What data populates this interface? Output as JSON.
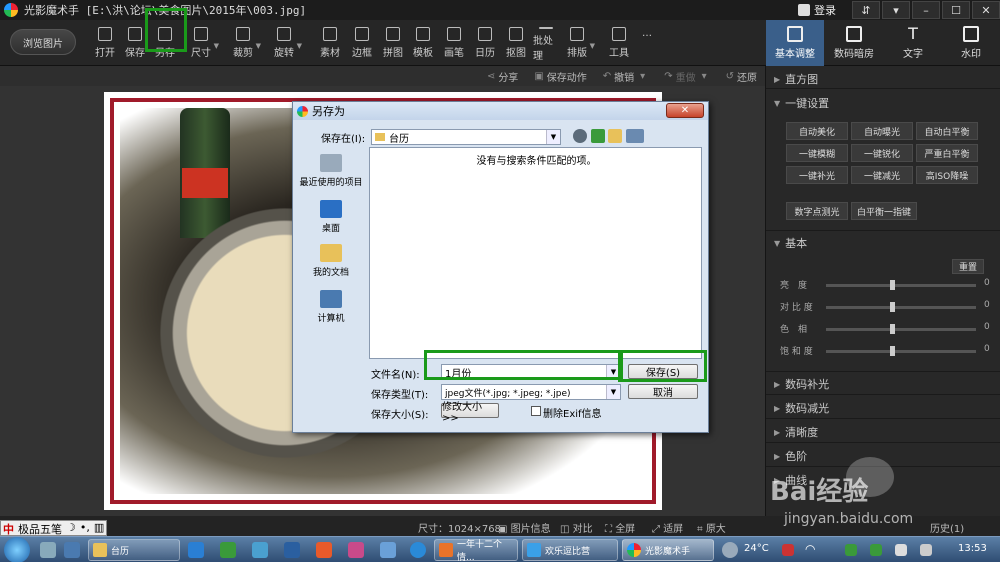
{
  "app": {
    "name": "光影魔术手",
    "title_path": "[E:\\洪\\论坛\\美食图片\\2015年\\003.jpg]",
    "login": "登录"
  },
  "toolbar": {
    "browse": "浏览图片",
    "tools": [
      "打开",
      "保存",
      "另存",
      "尺寸",
      "裁剪",
      "旋转",
      "素材",
      "边框",
      "拼图",
      "模板",
      "画笔",
      "日历",
      "抠图",
      "批处理",
      "排版",
      "工具",
      "…"
    ],
    "panel_tabs": [
      "基本调整",
      "数码暗房",
      "文字",
      "水印"
    ]
  },
  "actionbar": [
    "分享",
    "保存动作",
    "撤销",
    "重做",
    "还原"
  ],
  "dialog": {
    "title": "另存为",
    "save_in_label": "保存在(I):",
    "folder": "台历",
    "empty_message": "没有与搜索条件匹配的项。",
    "places": [
      "最近使用的项目",
      "桌面",
      "我的文档",
      "计算机"
    ],
    "filename_label": "文件名(N):",
    "filename_value": "1月份",
    "filetype_label": "保存类型(T):",
    "filetype_value": "jpeg文件(*.jpg; *.jpeg; *.jpe)",
    "size_label": "保存大小(S):",
    "change_size": "修改大小 >>",
    "exif_label": "删除Exif信息",
    "save_button": "保存(S)",
    "cancel_button": "取消"
  },
  "right_panel": {
    "histogram": "直方图",
    "one_click": "一键设置",
    "buttons": [
      "自动美化",
      "自动曝光",
      "自动白平衡",
      "一键模糊",
      "一键锐化",
      "严重白平衡",
      "一键补光",
      "一键减光",
      "高ISO降噪"
    ],
    "digital_point": "数字点测光",
    "white_balance": "白平衡一指键",
    "basic": "基本",
    "reset": "重置",
    "sliders": [
      {
        "label": "亮　度",
        "value": "0"
      },
      {
        "label": "对 比 度",
        "value": "0"
      },
      {
        "label": "色　相",
        "value": "0"
      },
      {
        "label": "饱 和 度",
        "value": "0"
      }
    ],
    "sections": [
      "数码补光",
      "数码减光",
      "清晰度",
      "色阶",
      "曲线"
    ]
  },
  "statusbar": {
    "size": "尺寸：1024×768",
    "info": "图片信息",
    "compare": "对比",
    "fullscreen": "全屏",
    "fit": "适屏",
    "original": "原大",
    "history": "历史(1)"
  },
  "ime": {
    "name": "极品五笔"
  },
  "taskbar": {
    "tasks": [
      "台历",
      "一年十二个情...",
      "欢乐逗比营",
      "光影魔术手"
    ],
    "weather": "24°C",
    "time": "13:53"
  },
  "watermark": {
    "brand": "Bai经验",
    "url": "jingyan.baidu.com"
  },
  "colors": {
    "highlight": "#1a9a1a",
    "active_tab": "#3a5f8a",
    "photo_border": "#a01a2a"
  }
}
